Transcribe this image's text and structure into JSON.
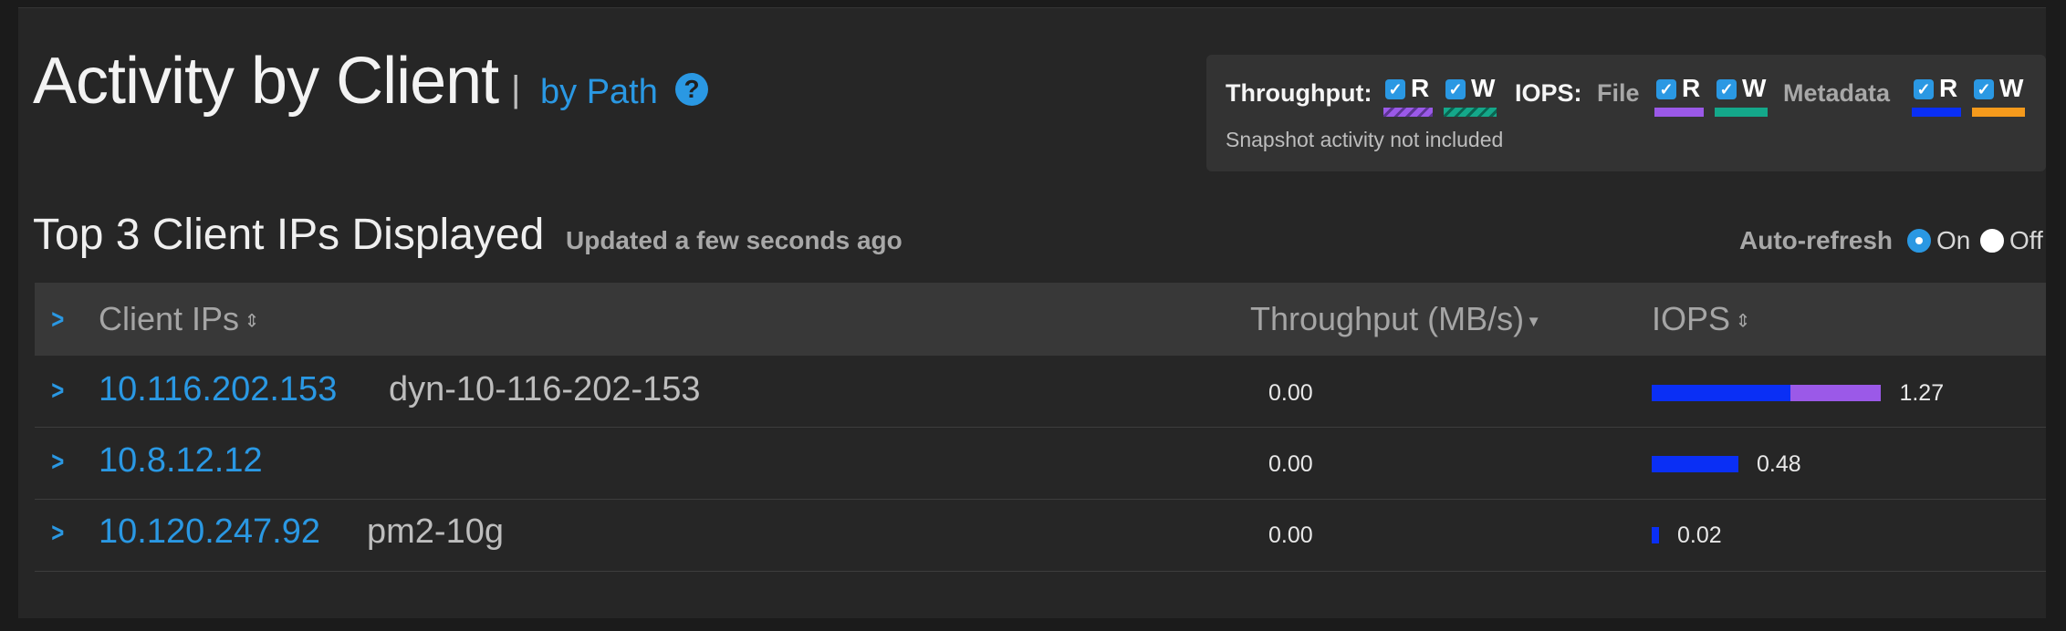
{
  "header": {
    "title": "Activity by Client",
    "separator": "|",
    "by_path_link": "by Path",
    "help_icon": "question-circle-icon"
  },
  "legend": {
    "throughput_label": "Throughput:",
    "iops_label": "IOPS:",
    "file_label": "File",
    "metadata_label": "Metadata",
    "read_label": "R",
    "write_label": "W",
    "checked": true,
    "snapshot_note": "Snapshot activity not included",
    "colors": {
      "throughput_read": "#9b59e8",
      "throughput_write": "#14a88a",
      "file_read": "#9b59e8",
      "file_write": "#14a88a",
      "metadata_read": "#0a2ff5",
      "metadata_write": "#f59a1c"
    }
  },
  "subheader": {
    "title": "Top 3 Client IPs Displayed",
    "updated": "Updated a few seconds ago",
    "auto_refresh_label": "Auto-refresh",
    "auto_refresh_on": "On",
    "auto_refresh_off": "Off",
    "auto_refresh_selected": "On"
  },
  "table": {
    "columns": {
      "client": "Client IPs",
      "throughput": "Throughput (MB/s)",
      "iops": "IOPS"
    },
    "sort": {
      "client_icon": "sort-icon",
      "throughput_icon": "caret-down-icon",
      "iops_icon": "sort-icon"
    },
    "rows": [
      {
        "ip": "10.116.202.153",
        "hostname": "dyn-10-116-202-153",
        "throughput": "0.00",
        "iops": "1.27",
        "iops_metadata_read": 0.77,
        "iops_file_read": 0.5
      },
      {
        "ip": "10.8.12.12",
        "hostname": "",
        "throughput": "0.00",
        "iops": "0.48",
        "iops_metadata_read": 0.48,
        "iops_file_read": 0
      },
      {
        "ip": "10.120.247.92",
        "hostname": "pm2-10g",
        "throughput": "0.00",
        "iops": "0.02",
        "iops_metadata_read": 0.02,
        "iops_file_read": 0
      }
    ]
  }
}
